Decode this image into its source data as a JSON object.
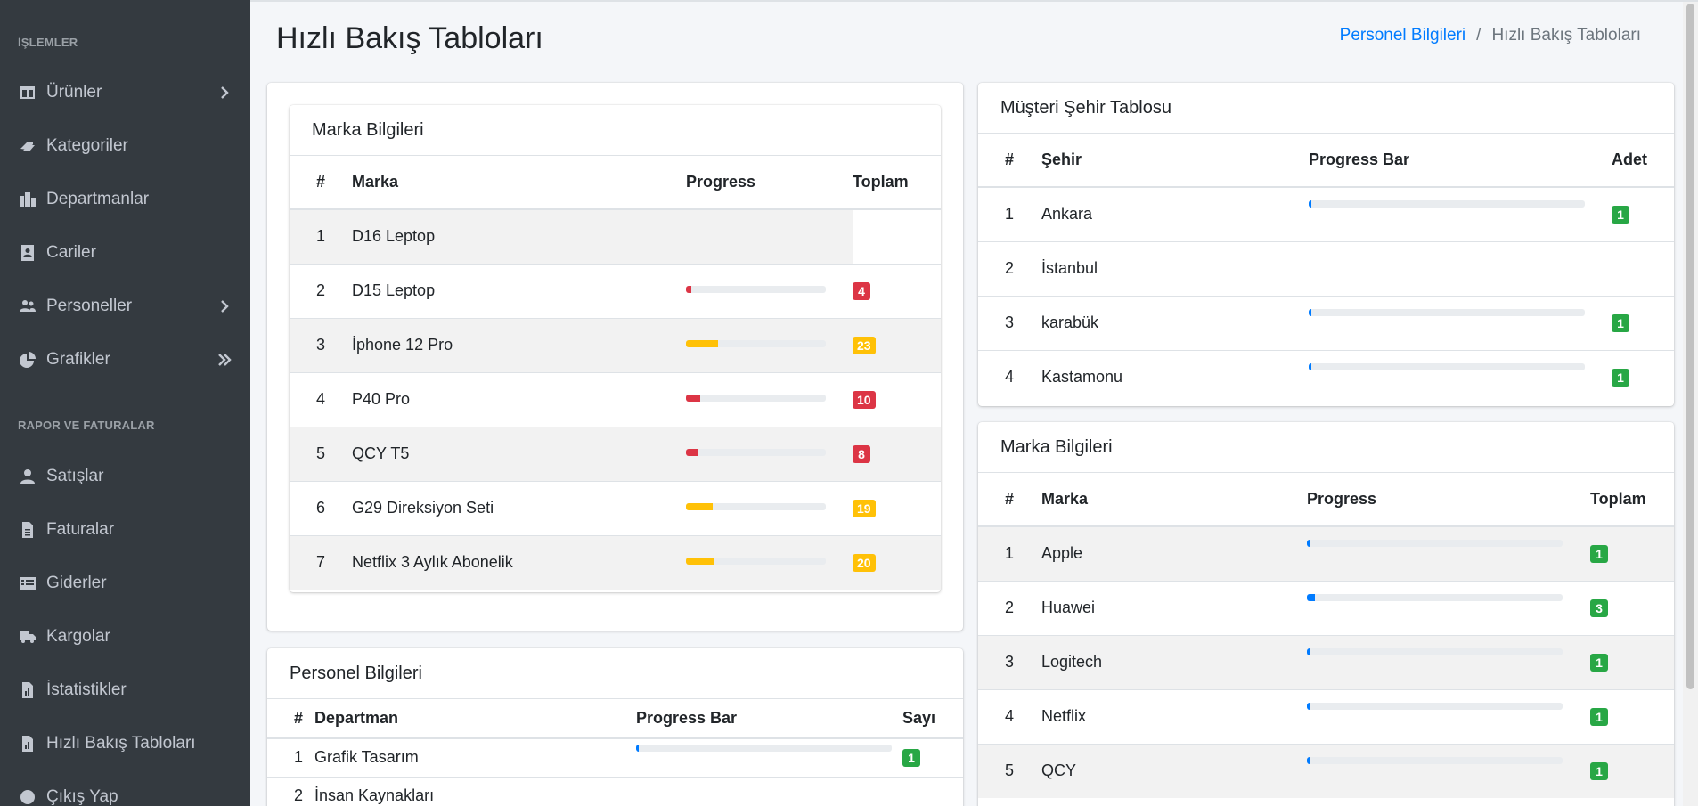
{
  "sidebar": {
    "section1": "İŞLEMLER",
    "section2": "RAPOR VE FATURALAR",
    "items": [
      {
        "label": "Ürünler",
        "icon": "table-icon",
        "arrow": "chevron"
      },
      {
        "label": "Kategoriler",
        "icon": "tags-icon",
        "arrow": ""
      },
      {
        "label": "Departmanlar",
        "icon": "building-icon",
        "arrow": ""
      },
      {
        "label": "Cariler",
        "icon": "address-card-icon",
        "arrow": ""
      },
      {
        "label": "Personeller",
        "icon": "users-icon",
        "arrow": "chevron"
      },
      {
        "label": "Grafikler",
        "icon": "chart-pie-icon",
        "arrow": "double-chevron"
      }
    ],
    "items2": [
      {
        "label": "Satışlar",
        "icon": "user-icon"
      },
      {
        "label": "Faturalar",
        "icon": "file-icon"
      },
      {
        "label": "Giderler",
        "icon": "list-card-icon"
      },
      {
        "label": "Kargolar",
        "icon": "truck-icon"
      },
      {
        "label": "İstatistikler",
        "icon": "file-chart-icon"
      },
      {
        "label": "Hızlı Bakış Tabloları",
        "icon": "file-chart-icon"
      },
      {
        "label": "Çıkış Yap",
        "icon": "logout-icon"
      }
    ]
  },
  "header": {
    "title": "Hızlı Bakış Tabloları",
    "breadcrumb_link": "Personel Bilgileri",
    "breadcrumb_sep": "/",
    "breadcrumb_current": "Hızlı Bakış Tabloları"
  },
  "marka1": {
    "title": "Marka Bilgileri",
    "columns": [
      "#",
      "Marka",
      "Progress",
      "Toplam"
    ],
    "rows": [
      {
        "n": "1",
        "name": "D16 Leptop",
        "pct": null,
        "count": "",
        "color": ""
      },
      {
        "n": "2",
        "name": "D15 Leptop",
        "pct": 4,
        "count": "4",
        "color": "#dc3545"
      },
      {
        "n": "3",
        "name": "İphone 12 Pro",
        "pct": 23,
        "count": "23",
        "color": "#ffc107"
      },
      {
        "n": "4",
        "name": "P40 Pro",
        "pct": 10,
        "count": "10",
        "color": "#dc3545"
      },
      {
        "n": "5",
        "name": "QCY T5",
        "pct": 8,
        "count": "8",
        "color": "#dc3545"
      },
      {
        "n": "6",
        "name": "G29 Direksiyon Seti",
        "pct": 19,
        "count": "19",
        "color": "#ffc107"
      },
      {
        "n": "7",
        "name": "Netflix 3 Aylık Abonelik",
        "pct": 20,
        "count": "20",
        "color": "#ffc107"
      }
    ]
  },
  "personel": {
    "title": "Personel Bilgileri",
    "columns": [
      "#",
      "Departman",
      "Progress Bar",
      "Sayı"
    ],
    "rows": [
      {
        "n": "1",
        "name": "Grafik Tasarım",
        "pct": 1,
        "count": "1"
      },
      {
        "n": "2",
        "name": "İnsan Kaynakları",
        "pct": null,
        "count": ""
      }
    ]
  },
  "sehir": {
    "title": "Müşteri Şehir Tablosu",
    "columns": [
      "#",
      "Şehir",
      "Progress Bar",
      "Adet"
    ],
    "rows": [
      {
        "n": "1",
        "name": "Ankara",
        "pct": 1,
        "count": "1"
      },
      {
        "n": "2",
        "name": "İstanbul",
        "pct": null,
        "count": ""
      },
      {
        "n": "3",
        "name": "karabük",
        "pct": 1,
        "count": "1"
      },
      {
        "n": "4",
        "name": "Kastamonu",
        "pct": 1,
        "count": "1"
      }
    ]
  },
  "marka2": {
    "title": "Marka Bilgileri",
    "columns": [
      "#",
      "Marka",
      "Progress",
      "Toplam"
    ],
    "rows": [
      {
        "n": "1",
        "name": "Apple",
        "pct": 1,
        "count": "1"
      },
      {
        "n": "2",
        "name": "Huawei",
        "pct": 3,
        "count": "3"
      },
      {
        "n": "3",
        "name": "Logitech",
        "pct": 1,
        "count": "1"
      },
      {
        "n": "4",
        "name": "Netflix",
        "pct": 1,
        "count": "1"
      },
      {
        "n": "5",
        "name": "QCY",
        "pct": 1,
        "count": "1"
      }
    ]
  },
  "colors": {
    "primary": "#007bff",
    "success": "#28a745",
    "danger": "#dc3545",
    "warning": "#ffc107",
    "sidebar": "#343a40"
  }
}
